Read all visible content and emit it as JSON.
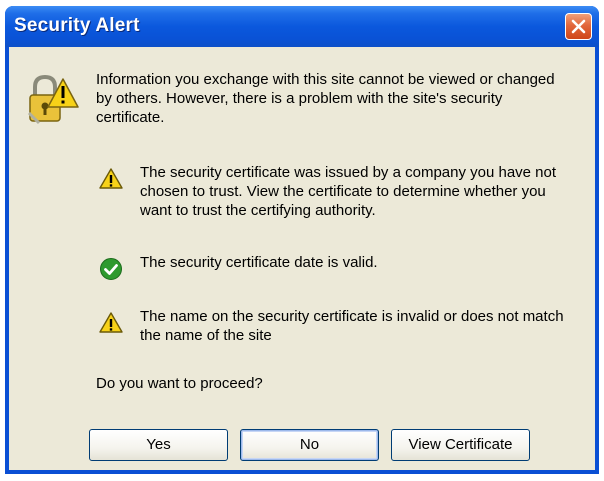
{
  "window": {
    "title": "Security Alert",
    "close_label": "Close"
  },
  "message": {
    "intro": "Information you exchange with this site cannot be viewed or changed by others. However, there is a problem with the site's security certificate.",
    "items": [
      {
        "status": "warning",
        "icon": "warning-icon",
        "text": "The security certificate was issued by a company you have not chosen to trust. View the certificate to determine whether you want to trust the certifying authority."
      },
      {
        "status": "ok",
        "icon": "check-icon",
        "text": "The security certificate date is valid."
      },
      {
        "status": "warning",
        "icon": "warning-icon",
        "text": "The name on the security certificate is invalid or does not match the name of the site"
      }
    ],
    "question": "Do you want to proceed?"
  },
  "buttons": {
    "yes": "Yes",
    "no": "No",
    "view_certificate": "View Certificate"
  },
  "colors": {
    "titlebar": "#0a52d6",
    "client": "#ece9d8",
    "warning": "#f7d218",
    "ok": "#2e9a2e",
    "close": "#e2673c"
  },
  "icons": {
    "header": "lock-warning-icon",
    "close": "close-icon"
  }
}
